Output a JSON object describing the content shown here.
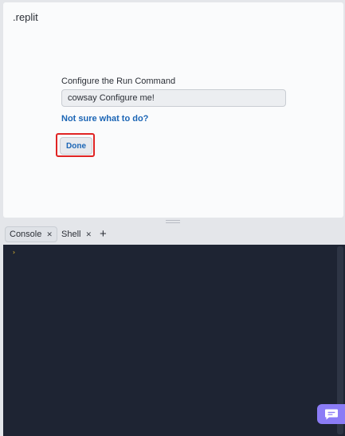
{
  "editor": {
    "file_title": ".replit",
    "config_label": "Configure the Run Command",
    "run_command_value": "cowsay Configure me!",
    "help_link": "Not sure what to do?",
    "done_label": "Done"
  },
  "terminal": {
    "tabs": [
      {
        "label": "Console",
        "active": true,
        "close_icon": "close-icon"
      },
      {
        "label": "Shell",
        "active": false,
        "close_icon": "close-icon"
      }
    ],
    "add_tab_symbol": "+",
    "prompt_symbol": "›"
  },
  "icons": {
    "chat": "chat-icon"
  },
  "colors": {
    "link": "#1b65b5",
    "highlight": "#e02424",
    "console_bg": "#1e2433",
    "prompt": "#f4c430",
    "chat_button": "#8b7cf6"
  }
}
